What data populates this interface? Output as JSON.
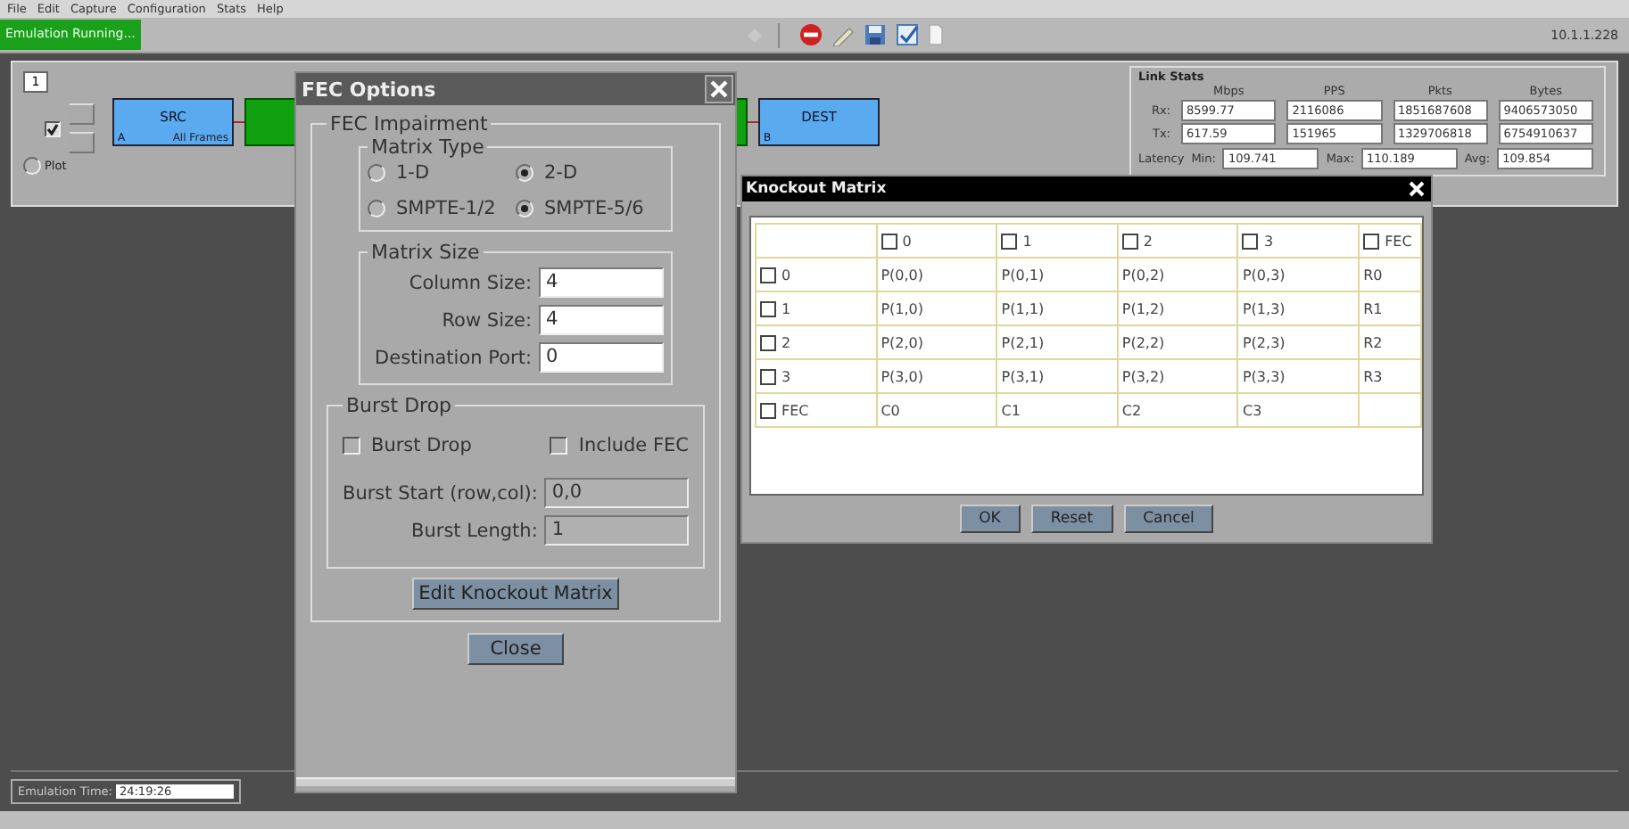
{
  "menu": [
    "File",
    "Edit",
    "Capture",
    "Configuration",
    "Stats",
    "Help"
  ],
  "status_badge": "Emulation Running...",
  "host_address": "10.1.1.228",
  "topology": {
    "port_number": "1",
    "enabled": {
      "checked": true
    },
    "plot": {
      "label": "Plot",
      "selected": false
    },
    "nodes": [
      {
        "kind": "endpoint",
        "name": "SRC",
        "port": "A",
        "filter": "All Frames"
      },
      {
        "kind": "impairment"
      },
      {
        "kind": "impairment"
      },
      {
        "kind": "endpoint",
        "name": "DEST",
        "port": "B"
      }
    ]
  },
  "link_stats": {
    "title": "Link Stats",
    "columns": [
      "Mbps",
      "PPS",
      "Pkts",
      "Bytes"
    ],
    "rows": [
      {
        "label": "Rx:",
        "values": [
          "8599.77",
          "2116086",
          "1851687608",
          "9406573050"
        ]
      },
      {
        "label": "Tx:",
        "values": [
          "617.59",
          "151965",
          "1329706818",
          "6754910637"
        ]
      }
    ],
    "latency": {
      "label": "Latency",
      "items": [
        {
          "label": "Min:",
          "value": "109.741"
        },
        {
          "label": "Max:",
          "value": "110.189"
        },
        {
          "label": "Avg:",
          "value": "109.854"
        }
      ]
    }
  },
  "emulation_time": {
    "label": "Emulation Time:",
    "value": "24:19:26"
  },
  "fec_dialog": {
    "title": "FEC Options",
    "group": "FEC Impairment",
    "matrix_type": {
      "title": "Matrix Type",
      "options": [
        {
          "label": "1-D",
          "selected": false
        },
        {
          "label": "2-D",
          "selected": true
        },
        {
          "label": "SMPTE-1/2",
          "selected": false
        },
        {
          "label": "SMPTE-5/6",
          "selected": true
        }
      ]
    },
    "matrix_size": {
      "title": "Matrix Size",
      "fields": [
        {
          "label": "Column Size:",
          "value": "4"
        },
        {
          "label": "Row Size:",
          "value": "4"
        },
        {
          "label": "Destination Port:",
          "value": "0"
        }
      ]
    },
    "burst_drop": {
      "title": "Burst Drop",
      "checks": [
        {
          "label": "Burst Drop",
          "checked": false
        },
        {
          "label": "Include FEC",
          "checked": false
        }
      ],
      "fields": [
        {
          "label": "Burst Start (row,col):",
          "value": "0,0",
          "disabled": true
        },
        {
          "label": "Burst Length:",
          "value": "1",
          "disabled": true
        }
      ]
    },
    "edit_button": "Edit Knockout Matrix",
    "close_button": "Close"
  },
  "knockout_dialog": {
    "title": "Knockout Matrix",
    "columns": [
      {
        "label": "0",
        "checked": false
      },
      {
        "label": "1",
        "checked": false
      },
      {
        "label": "2",
        "checked": false
      },
      {
        "label": "3",
        "checked": false
      },
      {
        "label": "FEC",
        "checked": false
      }
    ],
    "rows": [
      {
        "label": "0",
        "checked": false,
        "cells": [
          "P(0,0)",
          "P(0,1)",
          "P(0,2)",
          "P(0,3)",
          "R0"
        ]
      },
      {
        "label": "1",
        "checked": false,
        "cells": [
          "P(1,0)",
          "P(1,1)",
          "P(1,2)",
          "P(1,3)",
          "R1"
        ]
      },
      {
        "label": "2",
        "checked": false,
        "cells": [
          "P(2,0)",
          "P(2,1)",
          "P(2,2)",
          "P(2,3)",
          "R2"
        ]
      },
      {
        "label": "3",
        "checked": false,
        "cells": [
          "P(3,0)",
          "P(3,1)",
          "P(3,2)",
          "P(3,3)",
          "R3"
        ]
      },
      {
        "label": "FEC",
        "checked": false,
        "cells": [
          "C0",
          "C1",
          "C2",
          "C3",
          ""
        ]
      }
    ],
    "buttons": [
      "OK",
      "Reset",
      "Cancel"
    ]
  }
}
